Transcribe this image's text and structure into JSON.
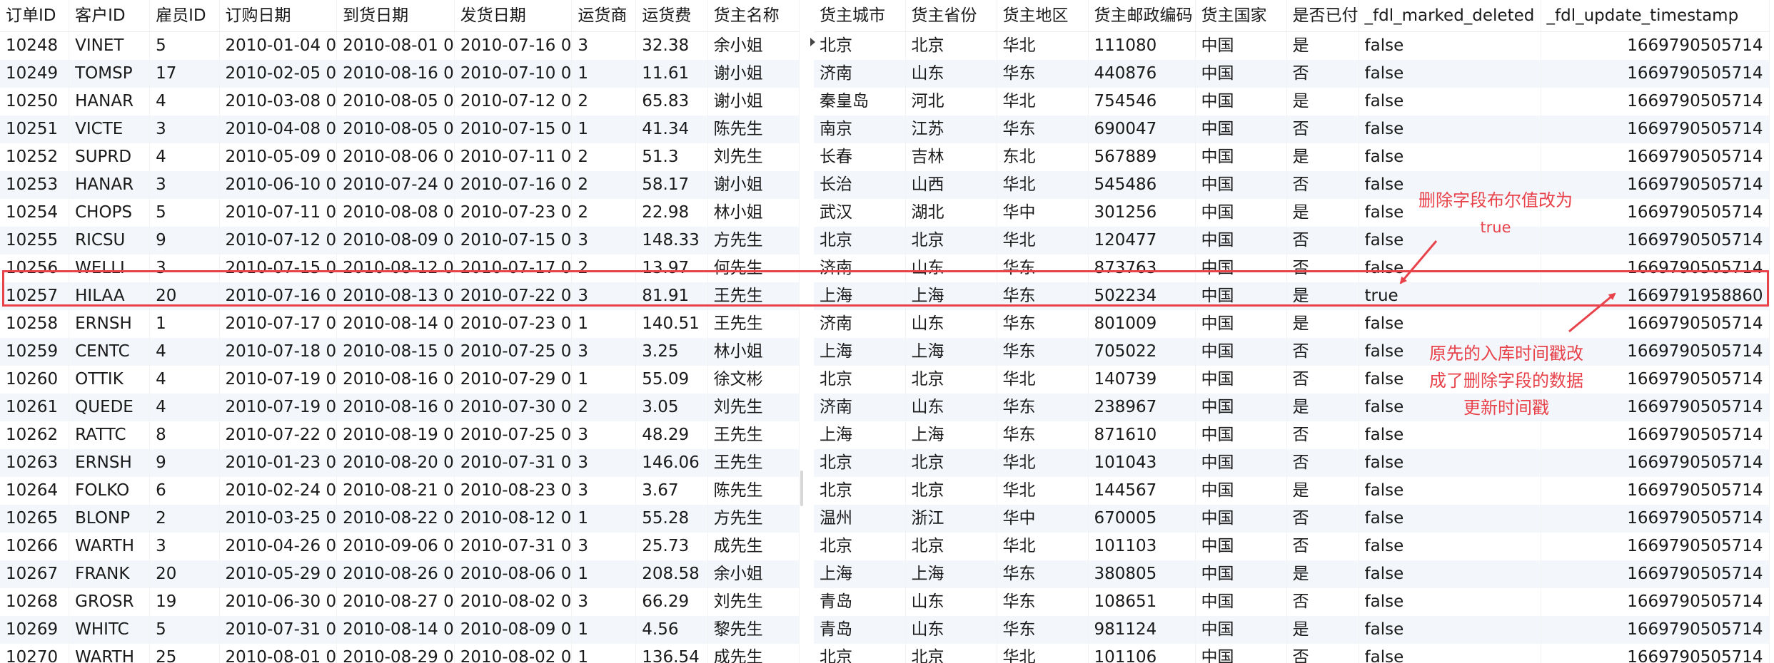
{
  "left_table": {
    "columns": [
      "订单ID",
      "客户ID",
      "雇员ID",
      "订购日期",
      "到货日期",
      "发货日期",
      "运货商",
      "运货费",
      "货主名称"
    ],
    "rows": [
      [
        "10248",
        "VINET",
        "5",
        "2010-01-04 0",
        "2010-08-01 0",
        "2010-07-16 0",
        "3",
        "32.38",
        "余小姐"
      ],
      [
        "10249",
        "TOMSP",
        "17",
        "2010-02-05 0",
        "2010-08-16 0",
        "2010-07-10 0",
        "1",
        "11.61",
        "谢小姐"
      ],
      [
        "10250",
        "HANAR",
        "4",
        "2010-03-08 0",
        "2010-08-05 0",
        "2010-07-12 0",
        "2",
        "65.83",
        "谢小姐"
      ],
      [
        "10251",
        "VICTE",
        "3",
        "2010-04-08 0",
        "2010-08-05 0",
        "2010-07-15 0",
        "1",
        "41.34",
        "陈先生"
      ],
      [
        "10252",
        "SUPRD",
        "4",
        "2010-05-09 0",
        "2010-08-06 0",
        "2010-07-11 0",
        "2",
        "51.3",
        "刘先生"
      ],
      [
        "10253",
        "HANAR",
        "3",
        "2010-06-10 0",
        "2010-07-24 0",
        "2010-07-16 0",
        "2",
        "58.17",
        "谢小姐"
      ],
      [
        "10254",
        "CHOPS",
        "5",
        "2010-07-11 0",
        "2010-08-08 0",
        "2010-07-23 0",
        "2",
        "22.98",
        "林小姐"
      ],
      [
        "10255",
        "RICSU",
        "9",
        "2010-07-12 0",
        "2010-08-09 0",
        "2010-07-15 0",
        "3",
        "148.33",
        "方先生"
      ],
      [
        "10256",
        "WELLI",
        "3",
        "2010-07-15 0",
        "2010-08-12 0",
        "2010-07-17 0",
        "2",
        "13.97",
        "何先生"
      ],
      [
        "10257",
        "HILAA",
        "20",
        "2010-07-16 0",
        "2010-08-13 0",
        "2010-07-22 0",
        "3",
        "81.91",
        "王先生"
      ],
      [
        "10258",
        "ERNSH",
        "1",
        "2010-07-17 0",
        "2010-08-14 0",
        "2010-07-23 0",
        "1",
        "140.51",
        "王先生"
      ],
      [
        "10259",
        "CENTC",
        "4",
        "2010-07-18 0",
        "2010-08-15 0",
        "2010-07-25 0",
        "3",
        "3.25",
        "林小姐"
      ],
      [
        "10260",
        "OTTIK",
        "4",
        "2010-07-19 0",
        "2010-08-16 0",
        "2010-07-29 0",
        "1",
        "55.09",
        "徐文彬"
      ],
      [
        "10261",
        "QUEDE",
        "4",
        "2010-07-19 0",
        "2010-08-16 0",
        "2010-07-30 0",
        "2",
        "3.05",
        "刘先生"
      ],
      [
        "10262",
        "RATTC",
        "8",
        "2010-07-22 0",
        "2010-08-19 0",
        "2010-07-25 0",
        "3",
        "48.29",
        "王先生"
      ],
      [
        "10263",
        "ERNSH",
        "9",
        "2010-01-23 0",
        "2010-08-20 0",
        "2010-07-31 0",
        "3",
        "146.06",
        "王先生"
      ],
      [
        "10264",
        "FOLKO",
        "6",
        "2010-02-24 0",
        "2010-08-21 0",
        "2010-08-23 0",
        "3",
        "3.67",
        "陈先生"
      ],
      [
        "10265",
        "BLONP",
        "2",
        "2010-03-25 0",
        "2010-08-22 0",
        "2010-08-12 0",
        "1",
        "55.28",
        "方先生"
      ],
      [
        "10266",
        "WARTH",
        "3",
        "2010-04-26 0",
        "2010-09-06 0",
        "2010-07-31 0",
        "3",
        "25.73",
        "成先生"
      ],
      [
        "10267",
        "FRANK",
        "20",
        "2010-05-29 0",
        "2010-08-26 0",
        "2010-08-06 0",
        "1",
        "208.58",
        "余小姐"
      ],
      [
        "10268",
        "GROSR",
        "19",
        "2010-06-30 0",
        "2010-08-27 0",
        "2010-08-02 0",
        "3",
        "66.29",
        "刘先生"
      ],
      [
        "10269",
        "WHITC",
        "5",
        "2010-07-31 0",
        "2010-08-14 0",
        "2010-08-09 0",
        "1",
        "4.56",
        "黎先生"
      ],
      [
        "10270",
        "WARTH",
        "25",
        "2010-08-01 0",
        "2010-08-29 0",
        "2010-08-02 0",
        "1",
        "136.54",
        "成先生"
      ]
    ]
  },
  "right_table": {
    "columns": [
      "货主城市",
      "货主省份",
      "货主地区",
      "货主邮政编码",
      "货主国家",
      "是否已付",
      "_fdl_marked_deleted",
      "_fdl_update_timestamp"
    ],
    "rows": [
      [
        "北京",
        "北京",
        "华北",
        "111080",
        "中国",
        "是",
        "false",
        "1669790505714"
      ],
      [
        "济南",
        "山东",
        "华东",
        "440876",
        "中国",
        "否",
        "false",
        "1669790505714"
      ],
      [
        "秦皇岛",
        "河北",
        "华北",
        "754546",
        "中国",
        "是",
        "false",
        "1669790505714"
      ],
      [
        "南京",
        "江苏",
        "华东",
        "690047",
        "中国",
        "否",
        "false",
        "1669790505714"
      ],
      [
        "长春",
        "吉林",
        "东北",
        "567889",
        "中国",
        "是",
        "false",
        "1669790505714"
      ],
      [
        "长治",
        "山西",
        "华北",
        "545486",
        "中国",
        "否",
        "false",
        "1669790505714"
      ],
      [
        "武汉",
        "湖北",
        "华中",
        "301256",
        "中国",
        "是",
        "false",
        "1669790505714"
      ],
      [
        "北京",
        "北京",
        "华北",
        "120477",
        "中国",
        "否",
        "false",
        "1669790505714"
      ],
      [
        "济南",
        "山东",
        "华东",
        "873763",
        "中国",
        "否",
        "false",
        "1669790505714"
      ],
      [
        "上海",
        "上海",
        "华东",
        "502234",
        "中国",
        "是",
        "true",
        "1669791958860"
      ],
      [
        "济南",
        "山东",
        "华东",
        "801009",
        "中国",
        "是",
        "false",
        "1669790505714"
      ],
      [
        "上海",
        "上海",
        "华东",
        "705022",
        "中国",
        "否",
        "false",
        "1669790505714"
      ],
      [
        "北京",
        "北京",
        "华北",
        "140739",
        "中国",
        "否",
        "false",
        "1669790505714"
      ],
      [
        "济南",
        "山东",
        "华东",
        "238967",
        "中国",
        "是",
        "false",
        "1669790505714"
      ],
      [
        "上海",
        "上海",
        "华东",
        "871610",
        "中国",
        "否",
        "false",
        "1669790505714"
      ],
      [
        "北京",
        "北京",
        "华北",
        "101043",
        "中国",
        "否",
        "false",
        "1669790505714"
      ],
      [
        "北京",
        "北京",
        "华北",
        "144567",
        "中国",
        "是",
        "false",
        "1669790505714"
      ],
      [
        "温州",
        "浙江",
        "华中",
        "670005",
        "中国",
        "否",
        "false",
        "1669790505714"
      ],
      [
        "北京",
        "北京",
        "华北",
        "101103",
        "中国",
        "否",
        "false",
        "1669790505714"
      ],
      [
        "上海",
        "上海",
        "华东",
        "380805",
        "中国",
        "是",
        "false",
        "1669790505714"
      ],
      [
        "青岛",
        "山东",
        "华东",
        "108651",
        "中国",
        "否",
        "false",
        "1669790505714"
      ],
      [
        "青岛",
        "山东",
        "华东",
        "981124",
        "中国",
        "是",
        "false",
        "1669790505714"
      ],
      [
        "北京",
        "北京",
        "华北",
        "101106",
        "中国",
        "否",
        "false",
        "1669790505714"
      ]
    ]
  },
  "annotations": {
    "note_top_line1": "删除字段布尔值改为",
    "note_top_line2": "true",
    "note_bottom_line1": "原先的入库时间戳改",
    "note_bottom_line2": "成了删除字段的数据",
    "note_bottom_line3": "更新时间戳",
    "color": "#e8424a"
  }
}
